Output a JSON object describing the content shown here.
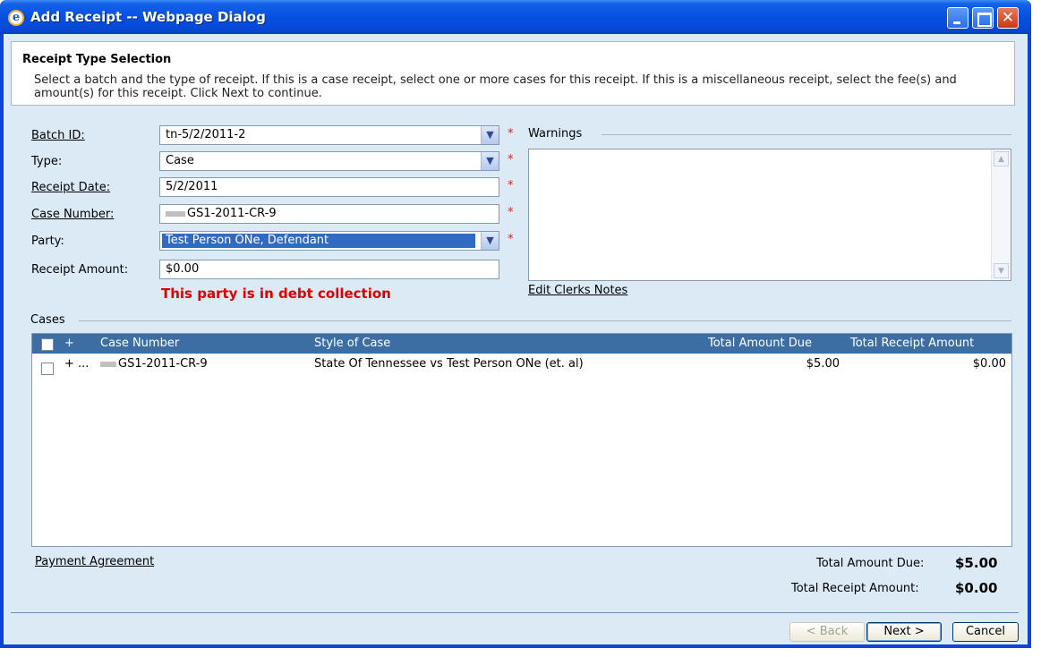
{
  "window": {
    "title": "Add Receipt -- Webpage Dialog",
    "close_glyph": "✕"
  },
  "header": {
    "title": "Receipt Type Selection",
    "description": "Select a batch and the type of receipt.  If this is a case receipt, select one or more cases for this receipt. If this is a miscellaneous receipt, select the fee(s) and amount(s) for this receipt. Click Next to continue."
  },
  "form": {
    "batch_label": "Batch ID:",
    "batch_value": "tn-5/2/2011-2",
    "type_label": "Type:",
    "type_value": "Case",
    "receipt_date_label": "Receipt Date:",
    "receipt_date_value": "5/2/2011",
    "case_number_label": "Case Number:",
    "case_number_value": "GS1-2011-CR-9",
    "party_label": "Party:",
    "party_value": "Test Person ONe, Defendant",
    "receipt_amount_label": "Receipt Amount:",
    "receipt_amount_value": "$0.00",
    "required_mark": "*",
    "debt_message": "This party is in debt collection"
  },
  "warnings": {
    "legend": "Warnings",
    "edit_notes_link": "Edit Clerks Notes"
  },
  "cases": {
    "legend": "Cases",
    "expand_glyph": "+",
    "columns": [
      "Case Number",
      "Style of Case",
      "Total Amount Due",
      "Total Receipt Amount"
    ],
    "rows": [
      {
        "expand": "+ ...",
        "case_number": "GS1-2011-CR-9",
        "style": "State Of Tennessee vs Test Person ONe (et. al)",
        "total_due": "$5.00",
        "total_receipt": "$0.00"
      }
    ]
  },
  "footer": {
    "payment_agreement_link": "Payment Agreement",
    "total_due_label": "Total Amount Due:",
    "total_due_value": "$5.00",
    "total_receipt_label": "Total Receipt Amount:",
    "total_receipt_value": "$0.00"
  },
  "buttons": {
    "back": "< Back",
    "next": "Next >",
    "cancel": "Cancel"
  },
  "icons": {
    "dropdown": "chevron-down-icon",
    "scroll_up": "scroll-up-icon",
    "scroll_down": "scroll-down-icon",
    "app": "ie-icon"
  },
  "colors": {
    "title_bar": "#0550e2",
    "grid_header": "#3d6ea3",
    "required": "#d22222",
    "debt_message": "#e00000",
    "party_highlight": "#316ac5"
  }
}
